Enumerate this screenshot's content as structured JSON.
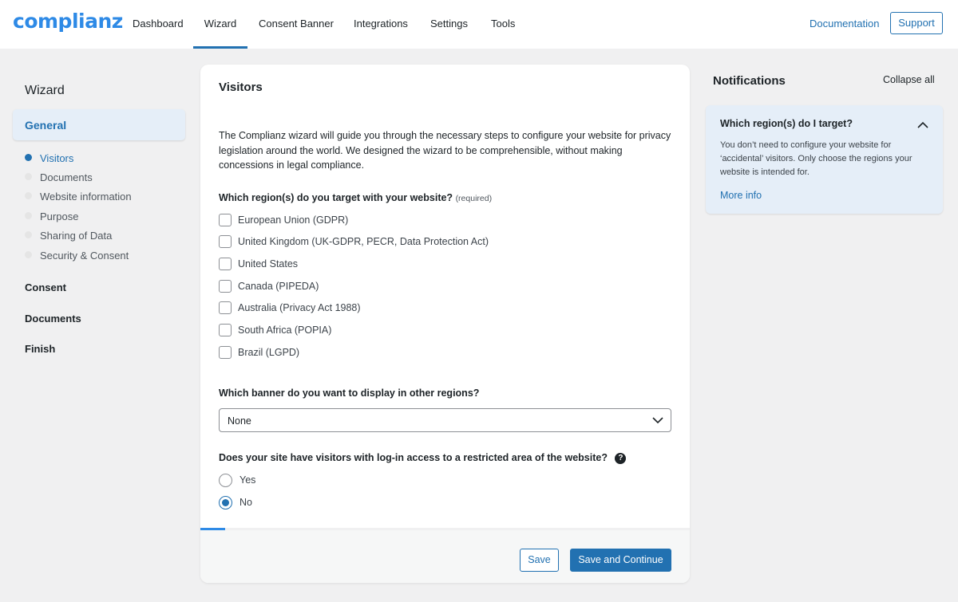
{
  "header": {
    "logo": "complianz",
    "nav": [
      "Dashboard",
      "Wizard",
      "Consent Banner",
      "Integrations",
      "Settings",
      "Tools"
    ],
    "active_nav": "Wizard",
    "documentation": "Documentation",
    "support": "Support"
  },
  "sidebar": {
    "title": "Wizard",
    "active_section": "General",
    "steps": [
      {
        "label": "Visitors",
        "active": true
      },
      {
        "label": "Documents",
        "active": false
      },
      {
        "label": "Website information",
        "active": false
      },
      {
        "label": "Purpose",
        "active": false
      },
      {
        "label": "Sharing of Data",
        "active": false
      },
      {
        "label": "Security & Consent",
        "active": false
      }
    ],
    "sections": [
      "Consent",
      "Documents",
      "Finish"
    ]
  },
  "main": {
    "title": "Visitors",
    "intro": "The Complianz wizard will guide you through the necessary steps to configure your website for privacy legislation around the world. We designed the wizard to be comprehensible, without making concessions in legal compliance.",
    "regions_question": "Which region(s) do you target with your website?",
    "required_label": "(required)",
    "regions": [
      {
        "label": "European Union (GDPR)",
        "checked": false
      },
      {
        "label": "United Kingdom (UK-GDPR, PECR, Data Protection Act)",
        "checked": false
      },
      {
        "label": "United States",
        "checked": false
      },
      {
        "label": "Canada (PIPEDA)",
        "checked": false
      },
      {
        "label": "Australia (Privacy Act 1988)",
        "checked": false
      },
      {
        "label": "South Africa (POPIA)",
        "checked": false
      },
      {
        "label": "Brazil (LGPD)",
        "checked": false
      }
    ],
    "banner_question": "Which banner do you want to display in other regions?",
    "banner_selected": "None",
    "login_question": "Does your site have visitors with log-in access to a restricted area of the website?",
    "help_glyph": "?",
    "login_options": [
      {
        "label": "Yes",
        "selected": false
      },
      {
        "label": "No",
        "selected": true
      }
    ],
    "progress": 0.05,
    "save": "Save",
    "save_continue": "Save and Continue"
  },
  "notifications": {
    "title": "Notifications",
    "collapse_all": "Collapse all",
    "item": {
      "title": "Which region(s) do I target?",
      "body": "You don’t need to configure your website for ‘accidental’ visitors. Only choose the regions your website is intended for.",
      "more": "More info"
    }
  },
  "colors": {
    "accent": "#2271b1",
    "logo": "#2e8ae6",
    "background": "#f0f0f1",
    "highlight": "#e5eef8"
  }
}
